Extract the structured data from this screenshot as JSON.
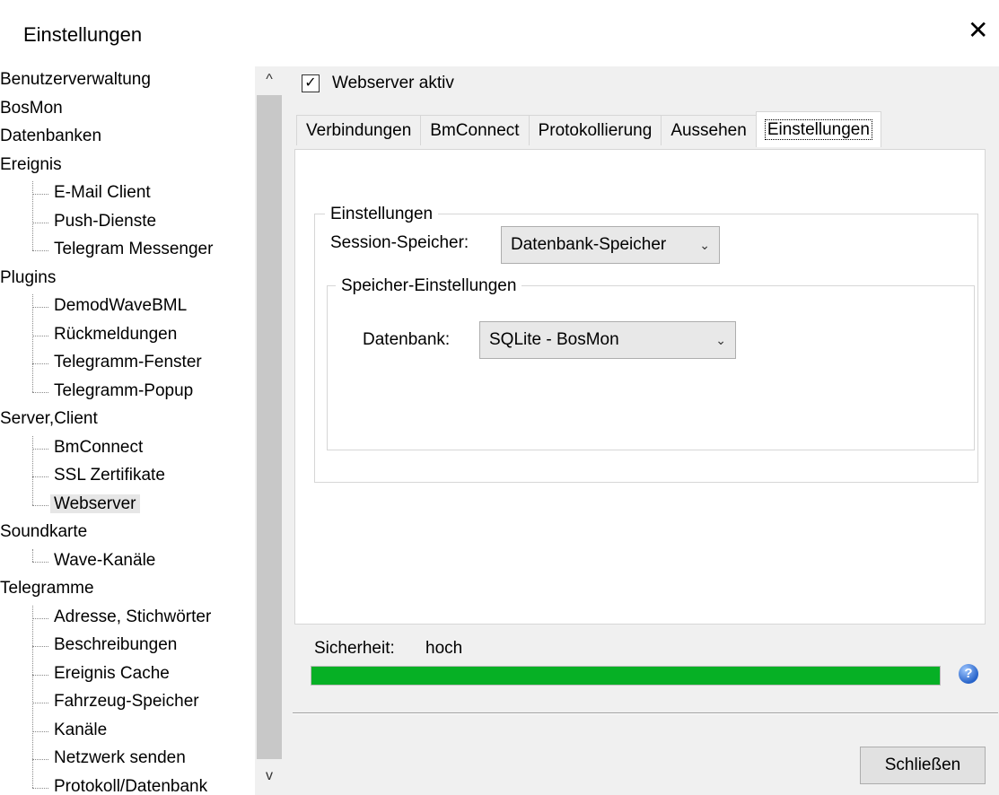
{
  "window": {
    "title": "Einstellungen",
    "close_symbol": "✕"
  },
  "tree": {
    "items": [
      {
        "label": "Benutzerverwaltung",
        "level": 0
      },
      {
        "label": "BosMon",
        "level": 0
      },
      {
        "label": "Datenbanken",
        "level": 0
      },
      {
        "label": "Ereignis",
        "level": 0
      },
      {
        "label": "E-Mail Client",
        "level": 1
      },
      {
        "label": "Push-Dienste",
        "level": 1
      },
      {
        "label": "Telegram Messenger",
        "level": 1
      },
      {
        "label": "Plugins",
        "level": 0
      },
      {
        "label": "DemodWaveBML",
        "level": 1
      },
      {
        "label": "Rückmeldungen",
        "level": 1
      },
      {
        "label": "Telegramm-Fenster",
        "level": 1
      },
      {
        "label": "Telegramm-Popup",
        "level": 1
      },
      {
        "label": "Server,Client",
        "level": 0
      },
      {
        "label": "BmConnect",
        "level": 1
      },
      {
        "label": "SSL Zertifikate",
        "level": 1
      },
      {
        "label": "Webserver",
        "level": 1,
        "selected": true
      },
      {
        "label": "Soundkarte",
        "level": 0
      },
      {
        "label": "Wave-Kanäle",
        "level": 1
      },
      {
        "label": "Telegramme",
        "level": 0
      },
      {
        "label": "Adresse, Stichwörter",
        "level": 1
      },
      {
        "label": "Beschreibungen",
        "level": 1
      },
      {
        "label": "Ereignis Cache",
        "level": 1
      },
      {
        "label": "Fahrzeug-Speicher",
        "level": 1
      },
      {
        "label": "Kanäle",
        "level": 1
      },
      {
        "label": "Netzwerk senden",
        "level": 1
      },
      {
        "label": "Protokoll/Datenbank",
        "level": 1
      }
    ]
  },
  "scrollbar": {
    "up": "^",
    "down": "v"
  },
  "webserver": {
    "checkbox_label": "Webserver aktiv",
    "checked": true,
    "check_mark": "✓"
  },
  "tabs": [
    "Verbindungen",
    "BmConnect",
    "Protokollierung",
    "Aussehen",
    "Einstellungen"
  ],
  "active_tab": "Einstellungen",
  "settings": {
    "group_title": "Einstellungen",
    "session_label": "Session-Speicher:",
    "session_value": "Datenbank-Speicher",
    "storage_group_title": "Speicher-Einstellungen",
    "db_label": "Datenbank:",
    "db_value": "SQLite - BosMon",
    "dropdown_arrow": "⌄"
  },
  "security": {
    "label": "Sicherheit:",
    "value": "hoch",
    "progress": 1.0,
    "bar_color": "#06b025",
    "help_symbol": "?"
  },
  "footer": {
    "close_button": "Schließen"
  }
}
